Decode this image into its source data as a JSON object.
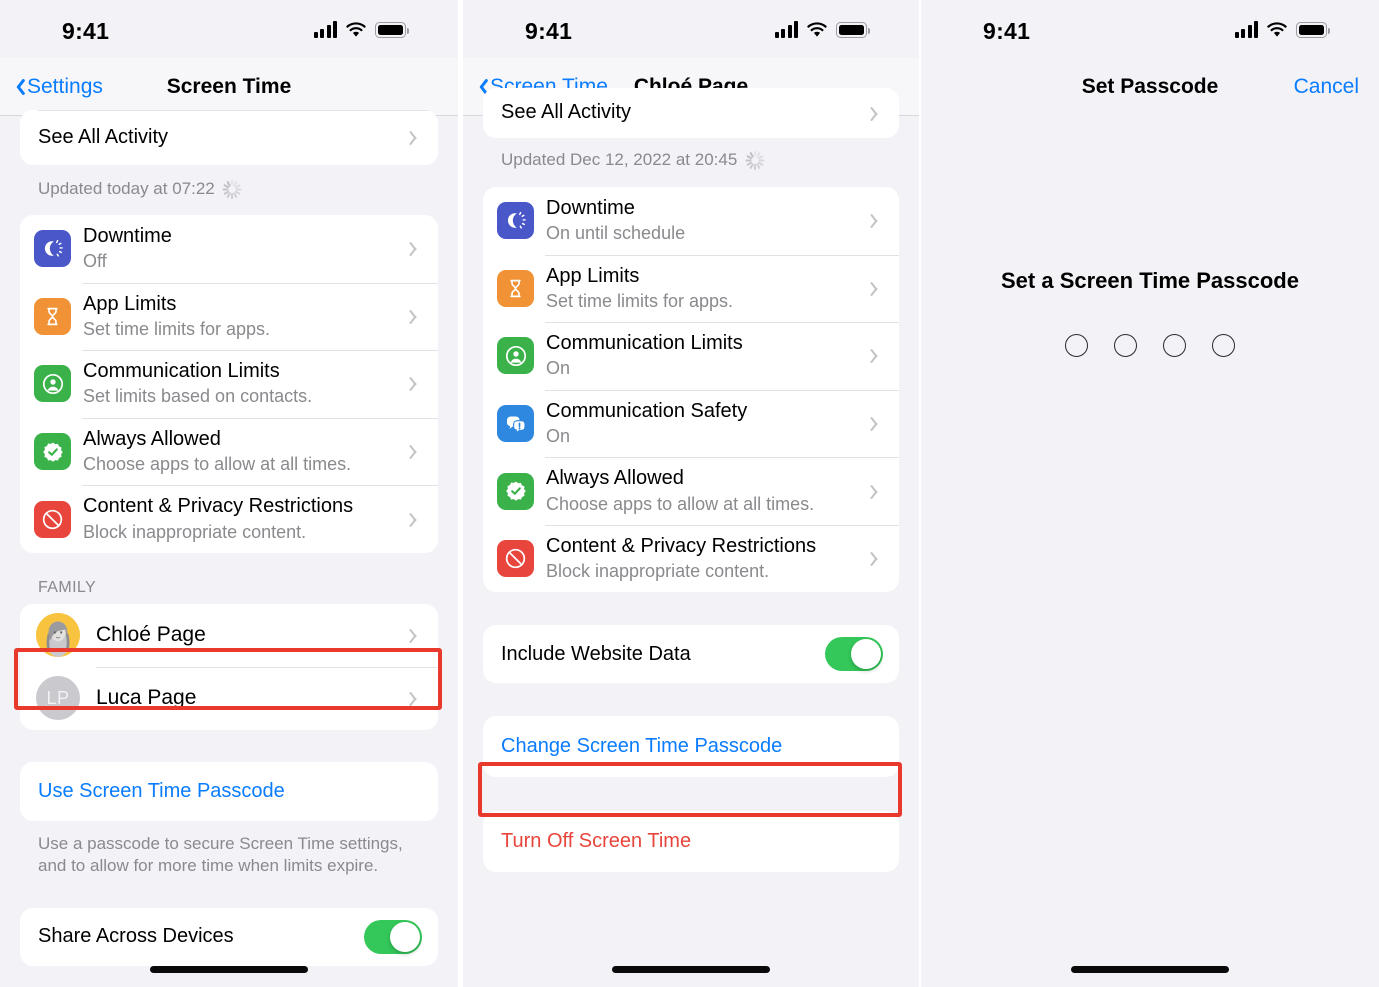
{
  "status_bar": {
    "time": "9:41",
    "signal_icon": "cellular-bars-icon",
    "wifi_icon": "wifi-icon",
    "battery_icon": "battery-full-icon"
  },
  "panel1": {
    "nav": {
      "back_label": "Settings",
      "title": "Screen Time"
    },
    "see_all_activity": "See All Activity",
    "updated": "Updated today at 07:22",
    "settings_rows": [
      {
        "title": "Downtime",
        "subtitle": "Off",
        "icon": "downtime-moon-icon",
        "color": "#4a57c8"
      },
      {
        "title": "App Limits",
        "subtitle": "Set time limits for apps.",
        "icon": "hourglass-icon",
        "color": "#f09235"
      },
      {
        "title": "Communication Limits",
        "subtitle": "Set limits based on contacts.",
        "icon": "person-circle-icon",
        "color": "#3bb14a"
      },
      {
        "title": "Always Allowed",
        "subtitle": "Choose apps to allow at all times.",
        "icon": "checkmark-seal-icon",
        "color": "#3bb14a"
      },
      {
        "title": "Content & Privacy Restrictions",
        "subtitle": "Block inappropriate content.",
        "icon": "no-entry-icon",
        "color": "#e8453c"
      }
    ],
    "family_header": "Family",
    "family": [
      {
        "name": "Chloé Page",
        "avatar": "photo",
        "initials": ""
      },
      {
        "name": "Luca Page",
        "avatar": "initials",
        "initials": "LP"
      }
    ],
    "use_passcode_link": "Use Screen Time Passcode",
    "passcode_footnote": "Use a passcode to secure Screen Time settings, and to allow for more time when limits expire.",
    "share_across_devices": {
      "label": "Share Across Devices",
      "value": "on"
    }
  },
  "panel2": {
    "nav": {
      "back_label": "Screen Time",
      "title": "Chloé Page"
    },
    "see_all_activity": "See All Activity",
    "updated": "Updated Dec 12, 2022 at 20:45",
    "settings_rows": [
      {
        "title": "Downtime",
        "subtitle": "On until schedule",
        "icon": "downtime-moon-icon",
        "color": "#4a57c8"
      },
      {
        "title": "App Limits",
        "subtitle": "Set time limits for apps.",
        "icon": "hourglass-icon",
        "color": "#f09235"
      },
      {
        "title": "Communication Limits",
        "subtitle": "On",
        "icon": "person-circle-icon",
        "color": "#3bb14a"
      },
      {
        "title": "Communication Safety",
        "subtitle": "On",
        "icon": "chat-bubbles-warning-icon",
        "color": "#2f88e0"
      },
      {
        "title": "Always Allowed",
        "subtitle": "Choose apps to allow at all times.",
        "icon": "checkmark-seal-icon",
        "color": "#3bb14a"
      },
      {
        "title": "Content & Privacy Restrictions",
        "subtitle": "Block inappropriate content.",
        "icon": "no-entry-icon",
        "color": "#e8453c"
      }
    ],
    "include_website_data": {
      "label": "Include Website Data",
      "value": "on"
    },
    "change_passcode_link": "Change Screen Time Passcode",
    "turn_off_link": "Turn Off Screen Time"
  },
  "panel3": {
    "nav": {
      "title": "Set Passcode",
      "cancel_label": "Cancel"
    },
    "prompt": "Set a Screen Time Passcode",
    "passcode_dots": 4
  },
  "annotations": {
    "highlight_color": "#e8392c"
  }
}
